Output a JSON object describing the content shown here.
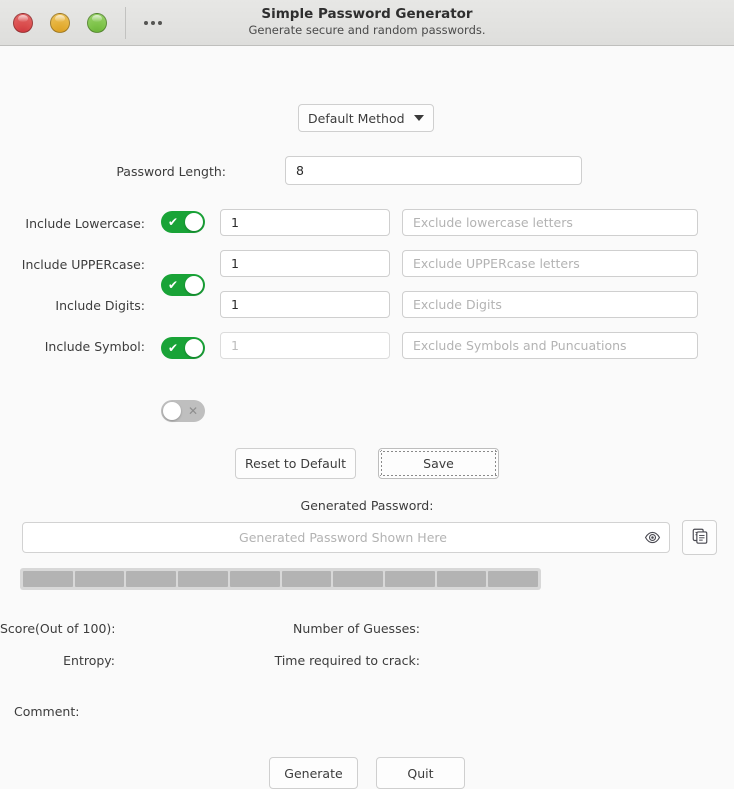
{
  "titlebar": {
    "title": "Simple Password Generator",
    "subtitle": "Generate secure and random passwords.",
    "menu_dots": "•••",
    "buttons": {
      "close": "close",
      "minimize": "minimize",
      "maximize": "maximize"
    }
  },
  "method": {
    "selected": "Default Method",
    "options": [
      "Default Method"
    ]
  },
  "password_length": {
    "label": "Password Length:",
    "value": "8"
  },
  "options": [
    {
      "label": "Include Lowercase:",
      "enabled": true,
      "toggle_mark": "✔",
      "count": "1",
      "exclude_placeholder": "Exclude lowercase letters",
      "exclude_value": ""
    },
    {
      "label": "Include UPPERcase:",
      "enabled": true,
      "toggle_mark": "✔",
      "count": "1",
      "exclude_placeholder": "Exclude UPPERcase letters",
      "exclude_value": ""
    },
    {
      "label": "Include Digits:",
      "enabled": true,
      "toggle_mark": "✔",
      "count": "1",
      "exclude_placeholder": "Exclude Digits",
      "exclude_value": ""
    },
    {
      "label": "Include Symbol:",
      "enabled": false,
      "toggle_mark": "✕",
      "count": "1",
      "exclude_placeholder": "Exclude Symbols and Puncuations",
      "exclude_value": ""
    }
  ],
  "actions": {
    "reset_label": "Reset to Default",
    "save_label": "Save"
  },
  "generated": {
    "heading": "Generated Password:",
    "placeholder": "Generated Password Shown Here",
    "value": "",
    "eye_icon": "eye-icon",
    "copy_icon": "copy-icon"
  },
  "meter": {
    "segments": 10,
    "filled": 0,
    "empty_color": "#b3b3b3",
    "track_color": "#d8d8d8"
  },
  "stats": {
    "score_label": "Score(Out of 100):",
    "score_value": "",
    "guesses_label": "Number of Guesses:",
    "guesses_value": "",
    "entropy_label": "Entropy:",
    "entropy_value": "",
    "crack_time_label": "Time required to crack:",
    "crack_time_value": "",
    "comment_label": "Comment:",
    "comment_value": ""
  },
  "footer": {
    "generate_label": "Generate",
    "quit_label": "Quit"
  },
  "colors": {
    "toggle_on": "#19a337",
    "toggle_off": "#bfbfbf",
    "background": "#fafafa",
    "titlebar": "#e1e1df"
  }
}
